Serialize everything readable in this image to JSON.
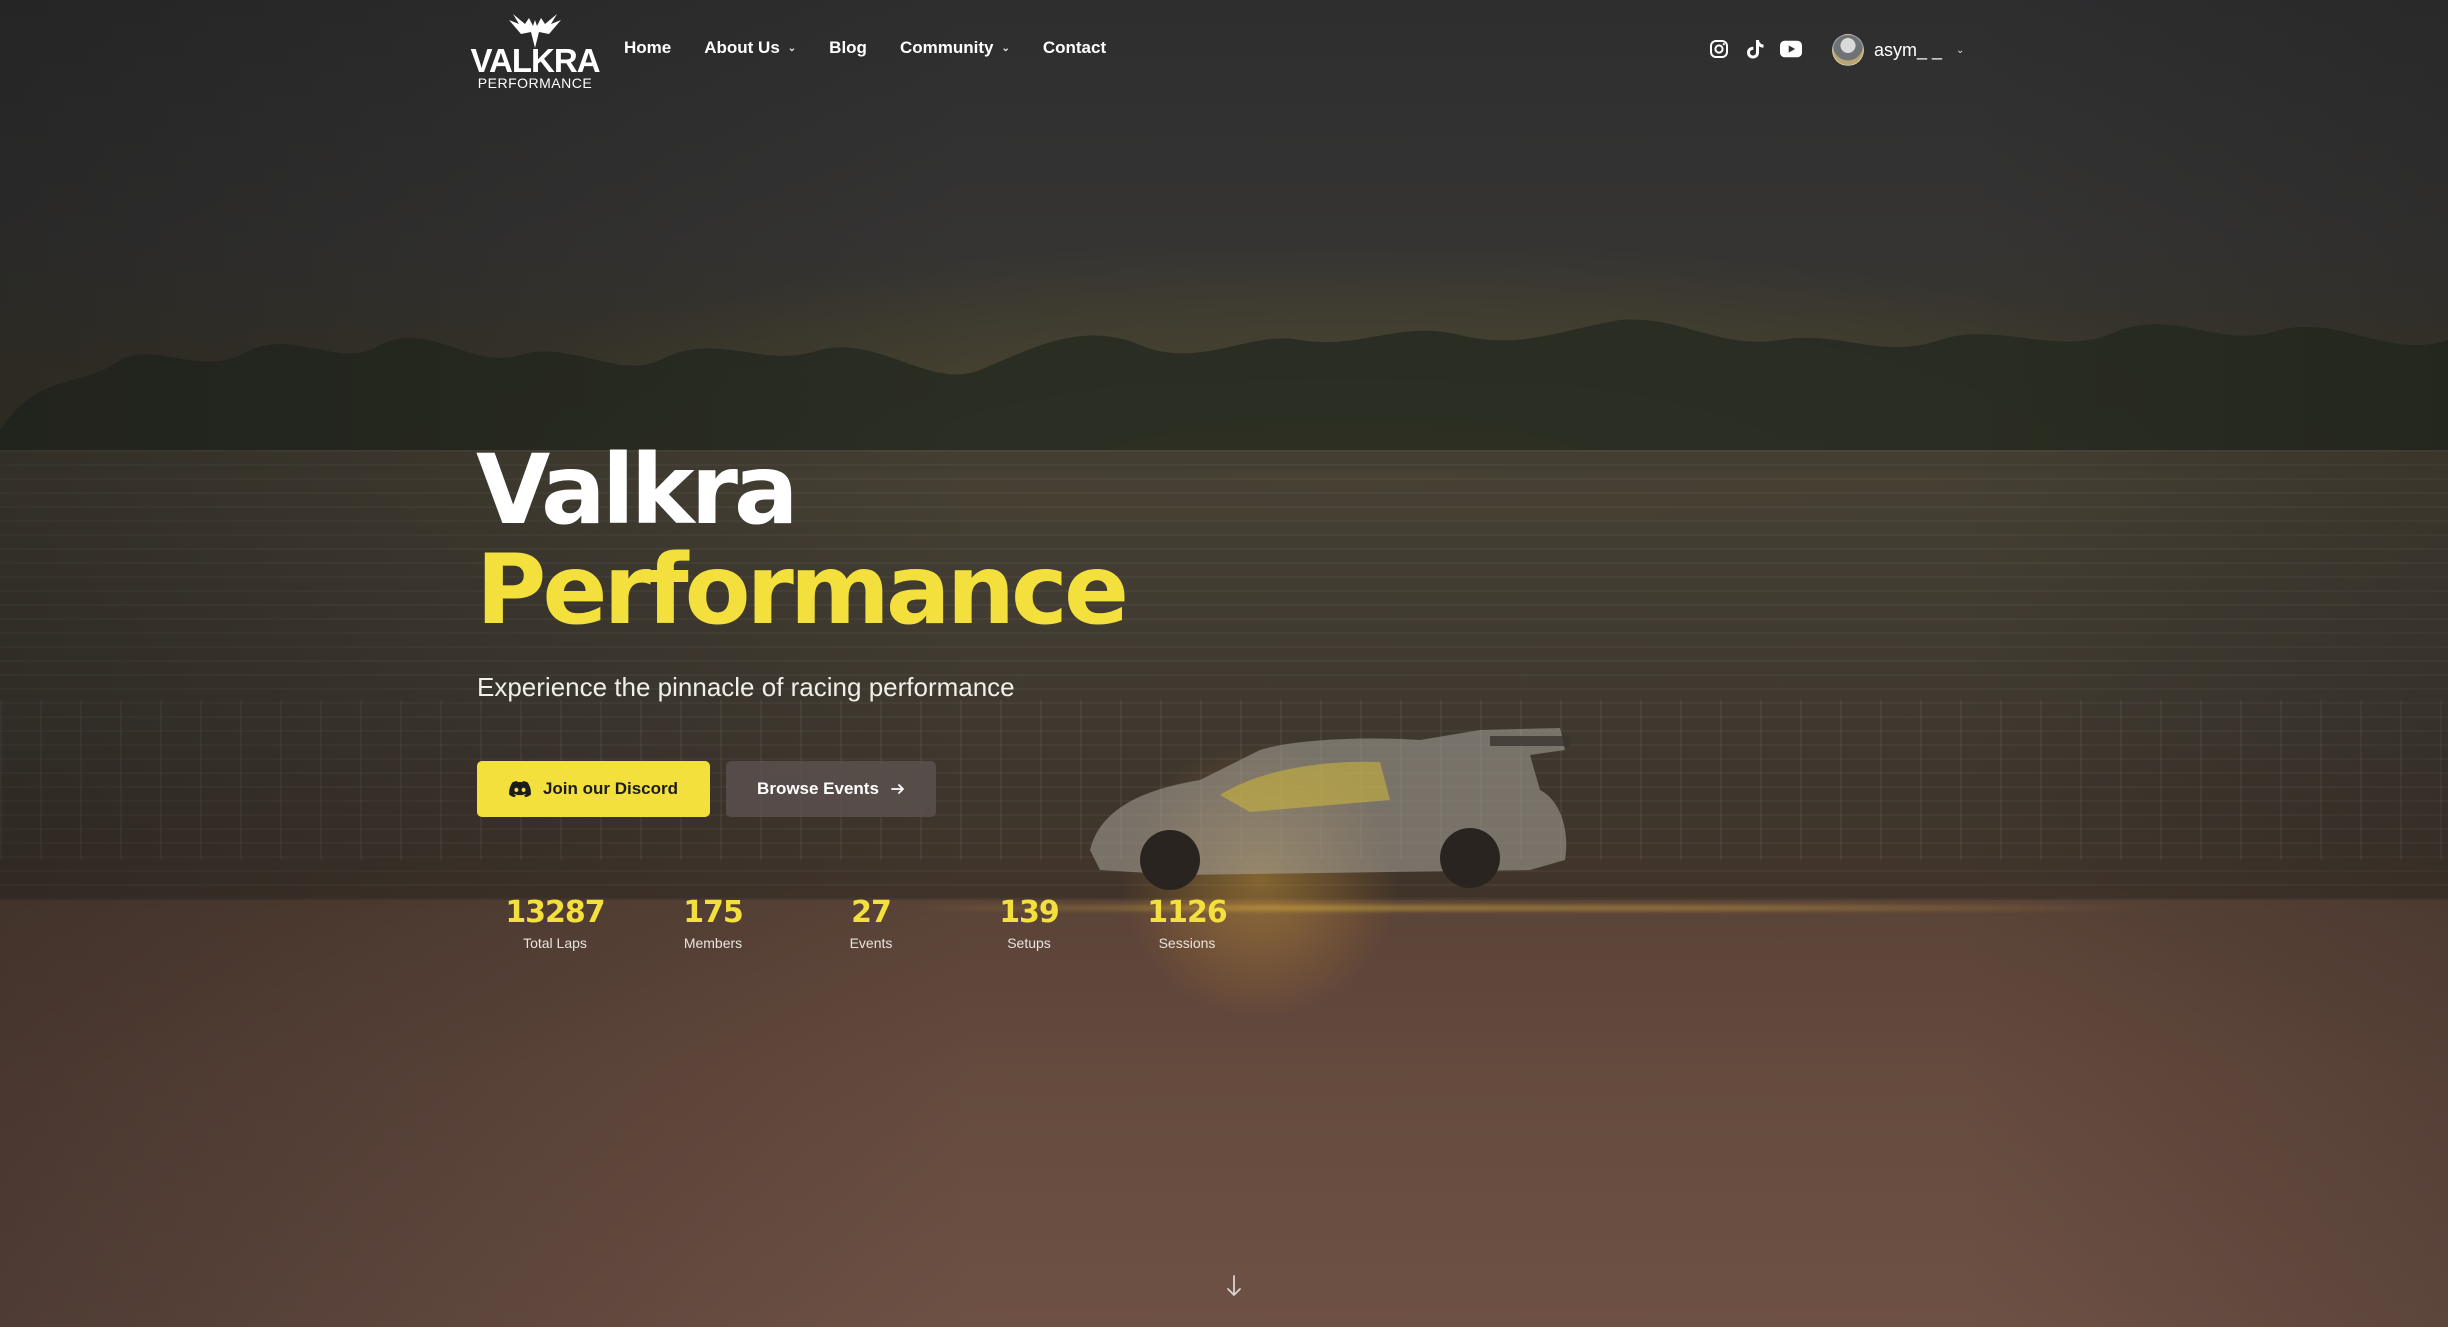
{
  "brand": {
    "logo_word": "VALKRA",
    "logo_sub": "PERFORMANCE"
  },
  "nav": {
    "home": "Home",
    "about": "About Us",
    "blog": "Blog",
    "community": "Community",
    "contact": "Contact"
  },
  "social": [
    "instagram-icon",
    "tiktok-icon",
    "youtube-icon"
  ],
  "user": {
    "name": "asym_ _"
  },
  "hero": {
    "title_line1": "Valkra",
    "title_line2": "Performance",
    "subtitle": "Experience the pinnacle of racing performance",
    "discord_button": "Join our Discord",
    "events_button": "Browse Events"
  },
  "stats": [
    {
      "value": "13287",
      "label": "Total Laps"
    },
    {
      "value": "175",
      "label": "Members"
    },
    {
      "value": "27",
      "label": "Events"
    },
    {
      "value": "139",
      "label": "Setups"
    },
    {
      "value": "1126",
      "label": "Sessions"
    }
  ],
  "colors": {
    "accent": "#f4e03c",
    "text": "#ffffff",
    "secondary_button": "#5a504e"
  }
}
